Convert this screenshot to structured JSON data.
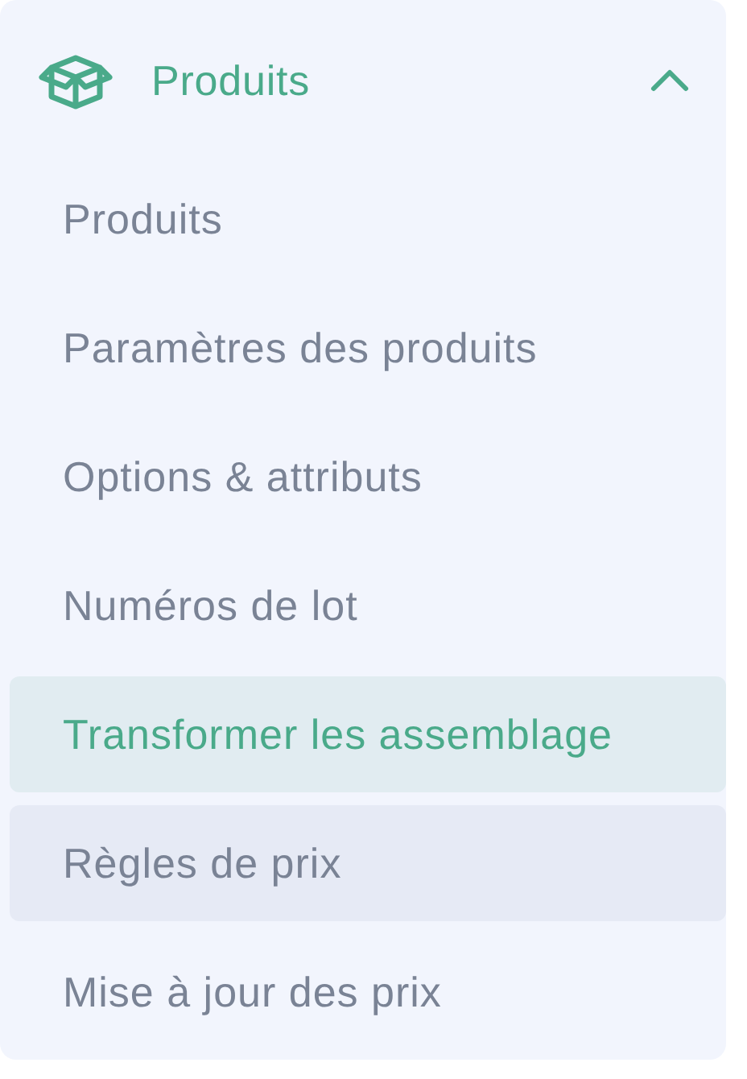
{
  "section": {
    "label": "Produits",
    "expanded": true
  },
  "items": [
    {
      "label": "Produits",
      "selected": false,
      "hovered": false
    },
    {
      "label": "Paramètres des produits",
      "selected": false,
      "hovered": false
    },
    {
      "label": "Options & attributs",
      "selected": false,
      "hovered": false
    },
    {
      "label": "Numéros de lot",
      "selected": false,
      "hovered": false
    },
    {
      "label": "Transformer les assemblage",
      "selected": true,
      "hovered": false
    },
    {
      "label": "Règles de prix",
      "selected": false,
      "hovered": true
    },
    {
      "label": "Mise à jour des prix",
      "selected": false,
      "hovered": false
    }
  ]
}
